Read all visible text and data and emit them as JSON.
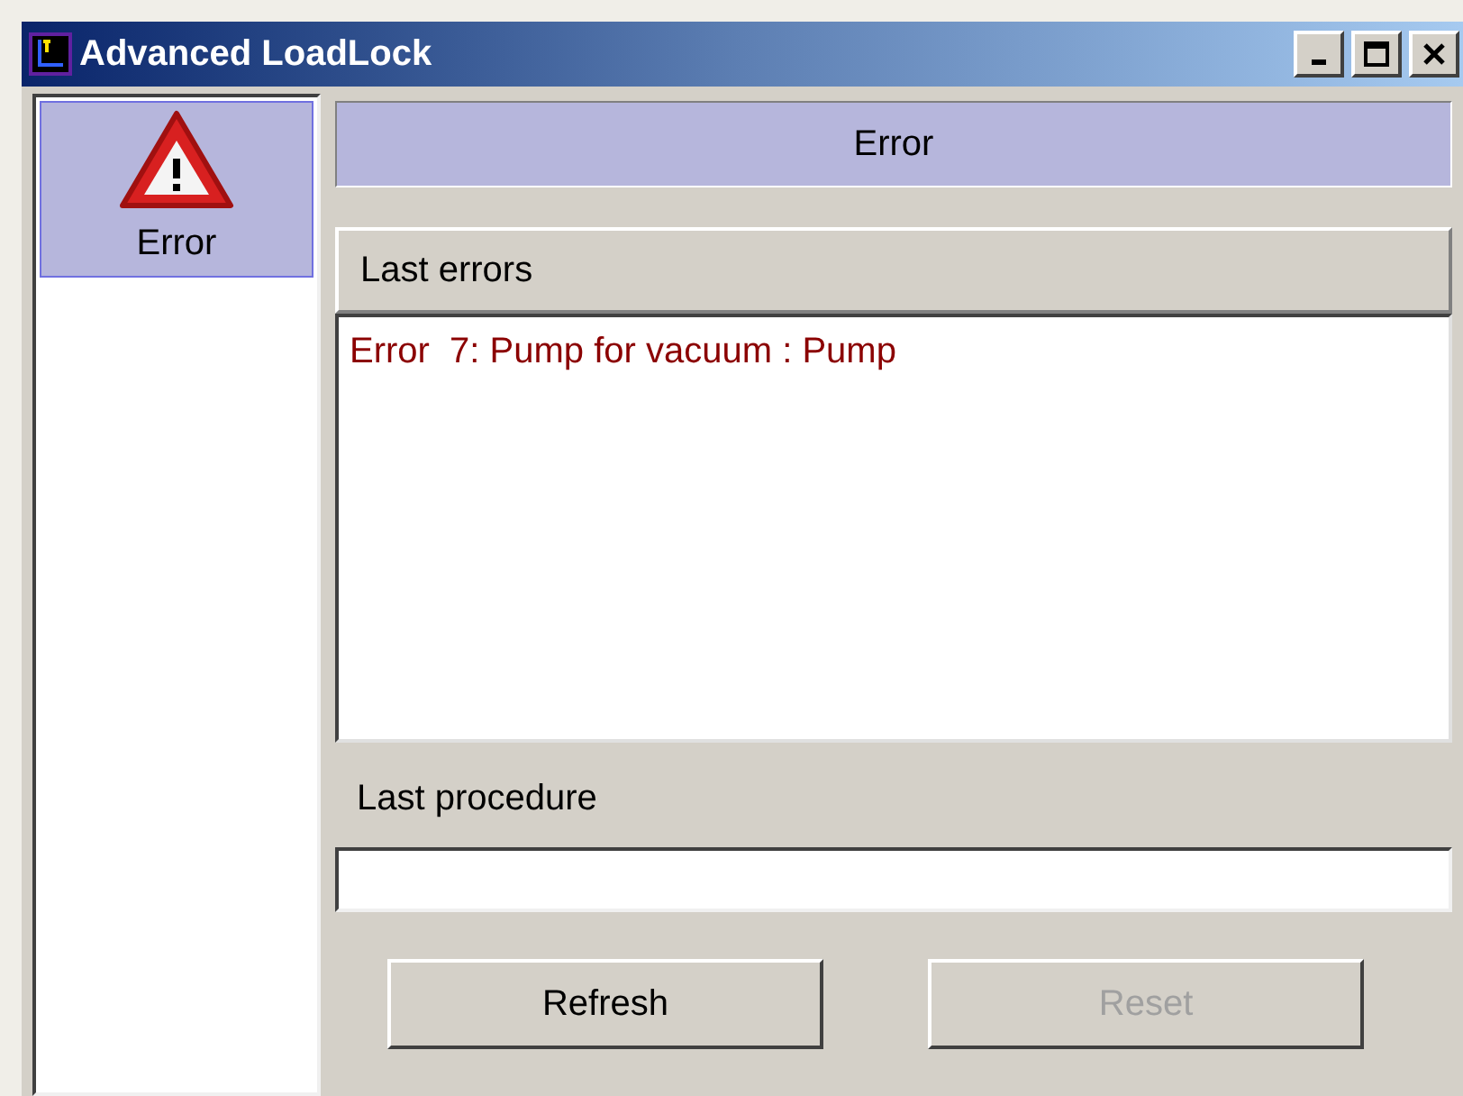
{
  "window": {
    "title": "Advanced LoadLock"
  },
  "sidebar": {
    "items": [
      {
        "label": "Error",
        "selected": true
      }
    ]
  },
  "header": {
    "title": "Error"
  },
  "errors": {
    "title": "Last errors",
    "lines": [
      "Error  7: Pump for vacuum : Pump"
    ]
  },
  "procedure": {
    "label": "Last procedure"
  },
  "buttons": [
    {
      "label": "Refresh",
      "disabled": false
    },
    {
      "label": "Reset",
      "disabled": true
    }
  ]
}
